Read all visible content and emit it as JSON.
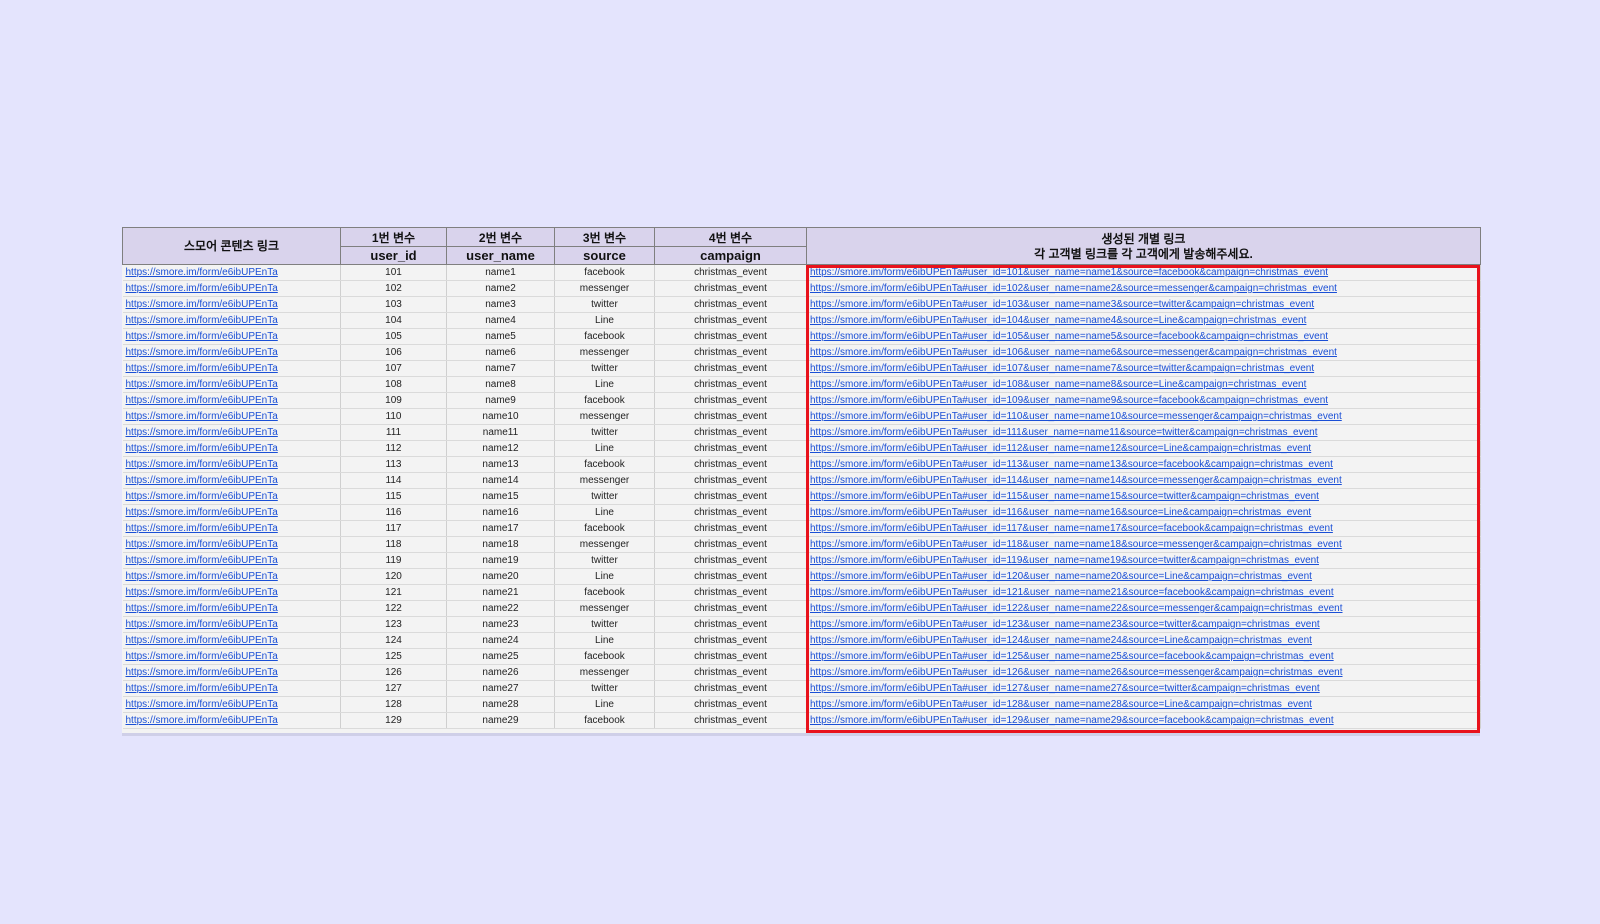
{
  "headers": {
    "content_link": "스모어 콘텐츠 링크",
    "var1_label": "1번 변수",
    "var2_label": "2번 변수",
    "var3_label": "3번 변수",
    "var4_label": "4번 변수",
    "var1_name": "user_id",
    "var2_name": "user_name",
    "var3_name": "source",
    "var4_name": "campaign",
    "generated_title": "생성된 개별 링크",
    "generated_subtitle": "각 고객별 링크를 각 고객에게 발송해주세요."
  },
  "base_link": "https://smore.im/form/e6ibUPEnTa",
  "rows": [
    {
      "user_id": "101",
      "user_name": "name1",
      "source": "facebook",
      "campaign": "christmas_event",
      "link": "https://smore.im/form/e6ibUPEnTa#user_id=101&user_name=name1&source=facebook&campaign=christmas_event"
    },
    {
      "user_id": "102",
      "user_name": "name2",
      "source": "messenger",
      "campaign": "christmas_event",
      "link": "https://smore.im/form/e6ibUPEnTa#user_id=102&user_name=name2&source=messenger&campaign=christmas_event"
    },
    {
      "user_id": "103",
      "user_name": "name3",
      "source": "twitter",
      "campaign": "christmas_event",
      "link": "https://smore.im/form/e6ibUPEnTa#user_id=103&user_name=name3&source=twitter&campaign=christmas_event"
    },
    {
      "user_id": "104",
      "user_name": "name4",
      "source": "Line",
      "campaign": "christmas_event",
      "link": "https://smore.im/form/e6ibUPEnTa#user_id=104&user_name=name4&source=Line&campaign=christmas_event"
    },
    {
      "user_id": "105",
      "user_name": "name5",
      "source": "facebook",
      "campaign": "christmas_event",
      "link": "https://smore.im/form/e6ibUPEnTa#user_id=105&user_name=name5&source=facebook&campaign=christmas_event"
    },
    {
      "user_id": "106",
      "user_name": "name6",
      "source": "messenger",
      "campaign": "christmas_event",
      "link": "https://smore.im/form/e6ibUPEnTa#user_id=106&user_name=name6&source=messenger&campaign=christmas_event"
    },
    {
      "user_id": "107",
      "user_name": "name7",
      "source": "twitter",
      "campaign": "christmas_event",
      "link": "https://smore.im/form/e6ibUPEnTa#user_id=107&user_name=name7&source=twitter&campaign=christmas_event"
    },
    {
      "user_id": "108",
      "user_name": "name8",
      "source": "Line",
      "campaign": "christmas_event",
      "link": "https://smore.im/form/e6ibUPEnTa#user_id=108&user_name=name8&source=Line&campaign=christmas_event"
    },
    {
      "user_id": "109",
      "user_name": "name9",
      "source": "facebook",
      "campaign": "christmas_event",
      "link": "https://smore.im/form/e6ibUPEnTa#user_id=109&user_name=name9&source=facebook&campaign=christmas_event"
    },
    {
      "user_id": "110",
      "user_name": "name10",
      "source": "messenger",
      "campaign": "christmas_event",
      "link": "https://smore.im/form/e6ibUPEnTa#user_id=110&user_name=name10&source=messenger&campaign=christmas_event"
    },
    {
      "user_id": "111",
      "user_name": "name11",
      "source": "twitter",
      "campaign": "christmas_event",
      "link": "https://smore.im/form/e6ibUPEnTa#user_id=111&user_name=name11&source=twitter&campaign=christmas_event"
    },
    {
      "user_id": "112",
      "user_name": "name12",
      "source": "Line",
      "campaign": "christmas_event",
      "link": "https://smore.im/form/e6ibUPEnTa#user_id=112&user_name=name12&source=Line&campaign=christmas_event"
    },
    {
      "user_id": "113",
      "user_name": "name13",
      "source": "facebook",
      "campaign": "christmas_event",
      "link": "https://smore.im/form/e6ibUPEnTa#user_id=113&user_name=name13&source=facebook&campaign=christmas_event"
    },
    {
      "user_id": "114",
      "user_name": "name14",
      "source": "messenger",
      "campaign": "christmas_event",
      "link": "https://smore.im/form/e6ibUPEnTa#user_id=114&user_name=name14&source=messenger&campaign=christmas_event"
    },
    {
      "user_id": "115",
      "user_name": "name15",
      "source": "twitter",
      "campaign": "christmas_event",
      "link": "https://smore.im/form/e6ibUPEnTa#user_id=115&user_name=name15&source=twitter&campaign=christmas_event"
    },
    {
      "user_id": "116",
      "user_name": "name16",
      "source": "Line",
      "campaign": "christmas_event",
      "link": "https://smore.im/form/e6ibUPEnTa#user_id=116&user_name=name16&source=Line&campaign=christmas_event"
    },
    {
      "user_id": "117",
      "user_name": "name17",
      "source": "facebook",
      "campaign": "christmas_event",
      "link": "https://smore.im/form/e6ibUPEnTa#user_id=117&user_name=name17&source=facebook&campaign=christmas_event"
    },
    {
      "user_id": "118",
      "user_name": "name18",
      "source": "messenger",
      "campaign": "christmas_event",
      "link": "https://smore.im/form/e6ibUPEnTa#user_id=118&user_name=name18&source=messenger&campaign=christmas_event"
    },
    {
      "user_id": "119",
      "user_name": "name19",
      "source": "twitter",
      "campaign": "christmas_event",
      "link": "https://smore.im/form/e6ibUPEnTa#user_id=119&user_name=name19&source=twitter&campaign=christmas_event"
    },
    {
      "user_id": "120",
      "user_name": "name20",
      "source": "Line",
      "campaign": "christmas_event",
      "link": "https://smore.im/form/e6ibUPEnTa#user_id=120&user_name=name20&source=Line&campaign=christmas_event"
    },
    {
      "user_id": "121",
      "user_name": "name21",
      "source": "facebook",
      "campaign": "christmas_event",
      "link": "https://smore.im/form/e6ibUPEnTa#user_id=121&user_name=name21&source=facebook&campaign=christmas_event"
    },
    {
      "user_id": "122",
      "user_name": "name22",
      "source": "messenger",
      "campaign": "christmas_event",
      "link": "https://smore.im/form/e6ibUPEnTa#user_id=122&user_name=name22&source=messenger&campaign=christmas_event"
    },
    {
      "user_id": "123",
      "user_name": "name23",
      "source": "twitter",
      "campaign": "christmas_event",
      "link": "https://smore.im/form/e6ibUPEnTa#user_id=123&user_name=name23&source=twitter&campaign=christmas_event"
    },
    {
      "user_id": "124",
      "user_name": "name24",
      "source": "Line",
      "campaign": "christmas_event",
      "link": "https://smore.im/form/e6ibUPEnTa#user_id=124&user_name=name24&source=Line&campaign=christmas_event"
    },
    {
      "user_id": "125",
      "user_name": "name25",
      "source": "facebook",
      "campaign": "christmas_event",
      "link": "https://smore.im/form/e6ibUPEnTa#user_id=125&user_name=name25&source=facebook&campaign=christmas_event"
    },
    {
      "user_id": "126",
      "user_name": "name26",
      "source": "messenger",
      "campaign": "christmas_event",
      "link": "https://smore.im/form/e6ibUPEnTa#user_id=126&user_name=name26&source=messenger&campaign=christmas_event"
    },
    {
      "user_id": "127",
      "user_name": "name27",
      "source": "twitter",
      "campaign": "christmas_event",
      "link": "https://smore.im/form/e6ibUPEnTa#user_id=127&user_name=name27&source=twitter&campaign=christmas_event"
    },
    {
      "user_id": "128",
      "user_name": "name28",
      "source": "Line",
      "campaign": "christmas_event",
      "link": "https://smore.im/form/e6ibUPEnTa#user_id=128&user_name=name28&source=Line&campaign=christmas_event"
    },
    {
      "user_id": "129",
      "user_name": "name29",
      "source": "facebook",
      "campaign": "christmas_event",
      "link": "https://smore.im/form/e6ibUPEnTa#user_id=129&user_name=name29&source=facebook&campaign=christmas_event"
    }
  ],
  "colors": {
    "background": "#e4e4fd",
    "header_fill": "#d9d3ec",
    "link": "#1a4fd6",
    "highlight_border": "#e8121c"
  }
}
